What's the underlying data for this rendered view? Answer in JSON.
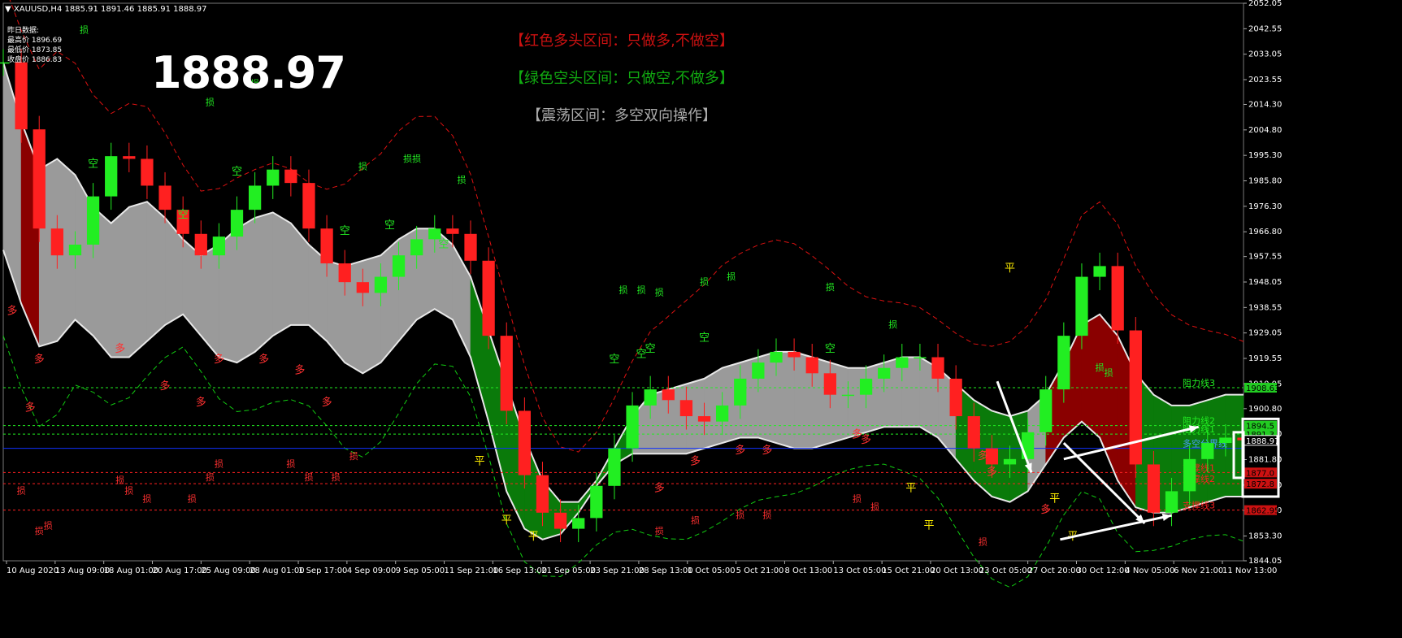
{
  "header": {
    "symbol": "XAUUSD,H4",
    "ohlc": "1885.91 1891.46 1885.91 1888.97"
  },
  "yesterday": {
    "title": "昨日数据:",
    "high": "最高价 1896.69",
    "low": "最低价 1873.85",
    "close": "收盘价 1886.83"
  },
  "current_price": "1888.97",
  "legend": {
    "bull": "【红色多头区间：只做多,不做空】",
    "bear": "【绿色空头区间：只做空,不做多】",
    "range": "【震荡区间：多空双向操作】"
  },
  "colors": {
    "bull_candle": "#ff2020",
    "bear_candle": "#22ee22",
    "band_gray": "#9a9a9a",
    "band_green": "#0a7a0a",
    "band_red": "#8a0000",
    "resistance_line": "#22ee22",
    "support_line": "#ff2020",
    "pivot_line": "#1030ff"
  },
  "chart_data": {
    "type": "line",
    "ylim": [
      1844.05,
      2052.05
    ],
    "y_ticks": [
      "2052.05",
      "2042.55",
      "2033.05",
      "2023.55",
      "2014.30",
      "2004.80",
      "1995.30",
      "1985.80",
      "1976.30",
      "1966.80",
      "1957.55",
      "1948.05",
      "1938.55",
      "1929.05",
      "1919.55",
      "1910.05",
      "1900.80",
      "1891.30",
      "1881.80",
      "1872.30",
      "1862.80",
      "1853.30",
      "1844.05"
    ],
    "x_ticks": [
      "10 Aug 2020",
      "13 Aug 09:00",
      "18 Aug 01:00",
      "20 Aug 17:00",
      "25 Aug 09:00",
      "28 Aug 01:00",
      "1 Sep 17:00",
      "4 Sep 09:00",
      "9 Sep 05:00",
      "11 Sep 21:00",
      "16 Sep 13:00",
      "21 Sep 05:00",
      "23 Sep 21:00",
      "28 Sep 13:00",
      "1 Oct 05:00",
      "5 Oct 21:00",
      "8 Oct 13:00",
      "13 Oct 05:00",
      "15 Oct 21:00",
      "20 Oct 13:00",
      "23 Oct 05:00",
      "27 Oct 20:00",
      "30 Oct 12:00",
      "4 Nov 05:00",
      "6 Nov 21:00",
      "11 Nov 13:00"
    ],
    "price_series": [
      2030,
      2005,
      1968,
      1958,
      1962,
      1980,
      1995,
      1994,
      1984,
      1975,
      1966,
      1958,
      1965,
      1975,
      1984,
      1990,
      1985,
      1968,
      1955,
      1948,
      1944,
      1950,
      1958,
      1964,
      1968,
      1966,
      1956,
      1928,
      1900,
      1876,
      1862,
      1856,
      1860,
      1872,
      1886,
      1902,
      1908,
      1904,
      1898,
      1896,
      1902,
      1912,
      1918,
      1922,
      1920,
      1914,
      1906,
      1906,
      1912,
      1916,
      1920,
      1920,
      1912,
      1898,
      1886,
      1880,
      1882,
      1892,
      1908,
      1928,
      1950,
      1954,
      1930,
      1880,
      1862,
      1870,
      1882,
      1888,
      1890,
      1889
    ],
    "band_upper": [
      2030,
      2008,
      1990,
      1994,
      1988,
      1976,
      1970,
      1976,
      1978,
      1972,
      1964,
      1958,
      1962,
      1968,
      1972,
      1974,
      1970,
      1962,
      1956,
      1954,
      1956,
      1958,
      1964,
      1968,
      1968,
      1962,
      1950,
      1930,
      1910,
      1890,
      1874,
      1866,
      1866,
      1874,
      1886,
      1898,
      1906,
      1908,
      1910,
      1912,
      1916,
      1918,
      1920,
      1922,
      1922,
      1920,
      1918,
      1916,
      1916,
      1918,
      1920,
      1920,
      1916,
      1910,
      1904,
      1900,
      1898,
      1900,
      1906,
      1918,
      1932,
      1936,
      1928,
      1914,
      1906,
      1902,
      1902,
      1904,
      1906,
      1906
    ],
    "band_lower": [
      1960,
      1940,
      1924,
      1926,
      1934,
      1928,
      1920,
      1920,
      1926,
      1932,
      1936,
      1928,
      1920,
      1918,
      1922,
      1928,
      1932,
      1932,
      1926,
      1918,
      1914,
      1918,
      1926,
      1934,
      1938,
      1934,
      1920,
      1896,
      1870,
      1856,
      1852,
      1854,
      1862,
      1872,
      1880,
      1884,
      1884,
      1884,
      1884,
      1886,
      1888,
      1890,
      1890,
      1888,
      1886,
      1886,
      1888,
      1890,
      1892,
      1894,
      1894,
      1894,
      1890,
      1882,
      1874,
      1868,
      1866,
      1870,
      1880,
      1890,
      1896,
      1890,
      1874,
      1864,
      1862,
      1862,
      1864,
      1866,
      1868,
      1868
    ],
    "zones": [
      "range",
      "bull",
      "range",
      "range",
      "range",
      "range",
      "range",
      "range",
      "range",
      "range",
      "range",
      "range",
      "range",
      "range",
      "range",
      "range",
      "range",
      "range",
      "range",
      "range",
      "range",
      "range",
      "range",
      "range",
      "range",
      "range",
      "bear",
      "bear",
      "bear",
      "bear",
      "bear",
      "bear",
      "bear",
      "bear",
      "bear",
      "range",
      "range",
      "range",
      "range",
      "range",
      "range",
      "range",
      "range",
      "range",
      "range",
      "range",
      "range",
      "range",
      "range",
      "range",
      "range",
      "range",
      "range",
      "bear",
      "bear",
      "bear",
      "bear",
      "range",
      "bull",
      "bull",
      "bull",
      "bull",
      "bull",
      "bear",
      "bear",
      "bear",
      "bear",
      "bear",
      "bear",
      "bear"
    ],
    "levels": [
      {
        "name": "阻力线3",
        "value": 1908.63,
        "kind": "resistance"
      },
      {
        "name": "阻力线2",
        "value": 1894.5,
        "kind": "resistance"
      },
      {
        "name": "阻力线1",
        "value": 1891.3,
        "kind": "resistance"
      },
      {
        "name": "多空分界线",
        "value": 1886.0,
        "kind": "pivot"
      },
      {
        "name": "支撑线1",
        "value": 1877.0,
        "kind": "support"
      },
      {
        "name": "支撑线2",
        "value": 1872.8,
        "kind": "support"
      },
      {
        "name": "支撑线3",
        "value": 1862.95,
        "kind": "support"
      }
    ],
    "price_tags": [
      {
        "label": "1908.63",
        "value": 1908.63,
        "kind": "resistance"
      },
      {
        "label": "1894.5",
        "value": 1894.5,
        "kind": "resistance"
      },
      {
        "label": "1891.3",
        "value": 1891.3,
        "kind": "resistance"
      },
      {
        "label": "1888.97",
        "value": 1888.97,
        "kind": "current"
      },
      {
        "label": "1877.0",
        "value": 1877.0,
        "kind": "support"
      },
      {
        "label": "1872.8",
        "value": 1872.8,
        "kind": "support"
      },
      {
        "label": "1862.95",
        "value": 1862.95,
        "kind": "support"
      }
    ],
    "markers": [
      {
        "t": 0.5,
        "text": "多",
        "value": 1936
      },
      {
        "t": 1.5,
        "text": "多",
        "value": 1900
      },
      {
        "t": 2.0,
        "text": "多",
        "value": 1918
      },
      {
        "t": 5.0,
        "text": "空",
        "value": 1991
      },
      {
        "t": 6.5,
        "text": "多",
        "value": 1922
      },
      {
        "t": 9.0,
        "text": "多",
        "value": 1908
      },
      {
        "t": 10.0,
        "text": "空",
        "value": 1972
      },
      {
        "t": 11.0,
        "text": "多",
        "value": 1902
      },
      {
        "t": 12.0,
        "text": "多",
        "value": 1918
      },
      {
        "t": 13.0,
        "text": "空",
        "value": 1988
      },
      {
        "t": 14.5,
        "text": "多",
        "value": 1918
      },
      {
        "t": 16.5,
        "text": "多",
        "value": 1914
      },
      {
        "t": 18.0,
        "text": "多",
        "value": 1902
      },
      {
        "t": 19.0,
        "text": "空",
        "value": 1966
      },
      {
        "t": 21.5,
        "text": "空",
        "value": 1968
      },
      {
        "t": 24.5,
        "text": "空",
        "value": 1961
      },
      {
        "t": 26.5,
        "text": "平",
        "value": 1880
      },
      {
        "t": 28.0,
        "text": "平",
        "value": 1858
      },
      {
        "t": 29.5,
        "text": "平",
        "value": 1852
      },
      {
        "t": 34.0,
        "text": "空",
        "value": 1918
      },
      {
        "t": 35.5,
        "text": "空",
        "value": 1920
      },
      {
        "t": 36.0,
        "text": "空",
        "value": 1922
      },
      {
        "t": 36.5,
        "text": "多",
        "value": 1870
      },
      {
        "t": 38.5,
        "text": "多",
        "value": 1880
      },
      {
        "t": 39.0,
        "text": "空",
        "value": 1926
      },
      {
        "t": 41.0,
        "text": "多",
        "value": 1884
      },
      {
        "t": 42.5,
        "text": "多",
        "value": 1884
      },
      {
        "t": 46.0,
        "text": "空",
        "value": 1922
      },
      {
        "t": 47.5,
        "text": "多",
        "value": 1890
      },
      {
        "t": 48.0,
        "text": "多",
        "value": 1888
      },
      {
        "t": 50.5,
        "text": "平",
        "value": 1870
      },
      {
        "t": 51.5,
        "text": "平",
        "value": 1856
      },
      {
        "t": 54.5,
        "text": "多",
        "value": 1882
      },
      {
        "t": 55.0,
        "text": "多",
        "value": 1876
      },
      {
        "t": 56.0,
        "text": "平",
        "value": 1952
      },
      {
        "t": 58.0,
        "text": "多",
        "value": 1862
      },
      {
        "t": 58.5,
        "text": "平",
        "value": 1866
      },
      {
        "t": 59.5,
        "text": "平",
        "value": 1852
      }
    ],
    "stop_marks": [
      {
        "t": 4.5,
        "text": "损",
        "value": 2041
      },
      {
        "t": 11.5,
        "text": "损",
        "value": 2014
      },
      {
        "t": 14.0,
        "text": "损",
        "value": 2021
      },
      {
        "t": 20.0,
        "text": "损",
        "value": 1990
      },
      {
        "t": 22.5,
        "text": "损",
        "value": 1993
      },
      {
        "t": 23.0,
        "text": "损",
        "value": 1993
      },
      {
        "t": 25.5,
        "text": "损",
        "value": 1985
      },
      {
        "t": 34.5,
        "text": "损",
        "value": 1944
      },
      {
        "t": 35.5,
        "text": "损",
        "value": 1944
      },
      {
        "t": 36.5,
        "text": "损",
        "value": 1943
      },
      {
        "t": 39.0,
        "text": "损",
        "value": 1947
      },
      {
        "t": 40.5,
        "text": "损",
        "value": 1949
      },
      {
        "t": 46.0,
        "text": "损",
        "value": 1945
      },
      {
        "t": 49.5,
        "text": "损",
        "value": 1931
      },
      {
        "t": 61.0,
        "text": "损",
        "value": 1915
      },
      {
        "t": 61.5,
        "text": "损",
        "value": 1913
      },
      {
        "t": 1.0,
        "text": "损",
        "value": 1869
      },
      {
        "t": 2.0,
        "text": "损",
        "value": 1854
      },
      {
        "t": 2.5,
        "text": "损",
        "value": 1856
      },
      {
        "t": 6.5,
        "text": "损",
        "value": 1873
      },
      {
        "t": 7.0,
        "text": "损",
        "value": 1869
      },
      {
        "t": 8.0,
        "text": "损",
        "value": 1866
      },
      {
        "t": 10.5,
        "text": "损",
        "value": 1866
      },
      {
        "t": 11.5,
        "text": "损",
        "value": 1874
      },
      {
        "t": 12.0,
        "text": "损",
        "value": 1879
      },
      {
        "t": 16.0,
        "text": "损",
        "value": 1879
      },
      {
        "t": 17.0,
        "text": "损",
        "value": 1874
      },
      {
        "t": 18.5,
        "text": "损",
        "value": 1874
      },
      {
        "t": 19.5,
        "text": "损",
        "value": 1882
      },
      {
        "t": 36.5,
        "text": "损",
        "value": 1854
      },
      {
        "t": 38.5,
        "text": "损",
        "value": 1858
      },
      {
        "t": 41.0,
        "text": "损",
        "value": 1860
      },
      {
        "t": 42.5,
        "text": "损",
        "value": 1860
      },
      {
        "t": 47.5,
        "text": "损",
        "value": 1866
      },
      {
        "t": 48.5,
        "text": "损",
        "value": 1863
      },
      {
        "t": 54.5,
        "text": "损",
        "value": 1850
      }
    ]
  }
}
